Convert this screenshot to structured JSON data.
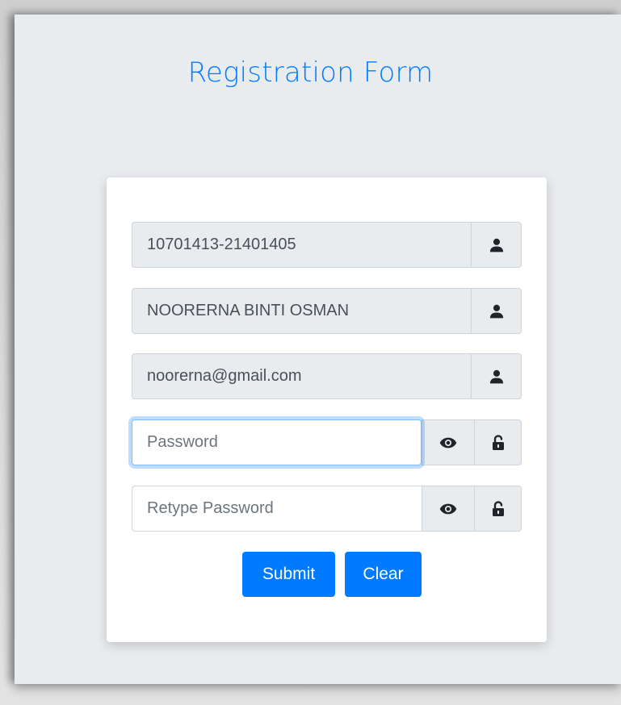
{
  "form": {
    "title": "Registration Form",
    "fields": [
      {
        "value": "10701413-21401405",
        "icon": "user-icon"
      },
      {
        "value": "NOORERNA BINTI OSMAN",
        "icon": "user-icon"
      },
      {
        "value": "noorerna@gmail.com",
        "icon": "user-icon"
      }
    ],
    "password": {
      "placeholder": "Password",
      "value": ""
    },
    "retype_password": {
      "placeholder": "Retype Password",
      "value": ""
    },
    "submit_label": "Submit",
    "clear_label": "Clear"
  },
  "colors": {
    "accent": "#007bff",
    "page_background": "#e9ecef",
    "card_background": "#ffffff",
    "addon_background": "#e9ecef",
    "border": "#ced4da"
  }
}
